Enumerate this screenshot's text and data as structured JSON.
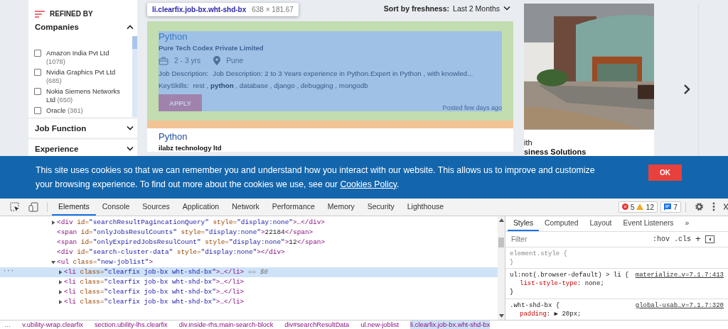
{
  "sidebar": {
    "title": "REFINED BY",
    "sections": [
      {
        "title": "Companies",
        "expanded": true,
        "options": [
          {
            "label": "Amazon India Pvt Ltd",
            "count": "(1078)",
            "checked": false
          },
          {
            "label": "Nvidia Graphics Pvt Ltd",
            "count": "(685)",
            "checked": false
          },
          {
            "label": "Nokia Siemens Networks Ltd",
            "count": "(650)",
            "checked": false
          },
          {
            "label": "Oracle",
            "count": "(381)",
            "checked": false
          }
        ]
      },
      {
        "title": "Job Function",
        "expanded": false
      },
      {
        "title": "Experience",
        "expanded": false
      }
    ]
  },
  "sort": {
    "label": "Sort by freshness:",
    "value": "Last 2 Months"
  },
  "inspect_tooltip": {
    "selector": "li.clearfix.job-bx.wht-shd-bx",
    "size": "638 × 181.67"
  },
  "jobs": [
    {
      "title": "Python",
      "company": "Pure Tech Codex Private Limited",
      "experience": "2 - 3 yrs",
      "location": "Pune",
      "description_label": "Job Description:",
      "description": "Job Description: 2 to 3 Years experience in Python.Expert in Python , with knowled...",
      "skills_label": "KeySkills:",
      "skills": "rest , **python** , database , django , debugging , mongodb",
      "button": "APPLY",
      "posted": "Posted few days ago",
      "highlighted": true
    },
    {
      "title": "Python",
      "company": "ilabz technology ltd",
      "highlighted": false
    }
  ],
  "promo": {
    "kind": "picture",
    "line_1": "ith",
    "line_2": "siness Solutions"
  },
  "cookie_banner": {
    "text": "This site uses cookies so that we can remember you and understand how you interact with our website. This allows us to improve and customize your browsing experience. To find out more about the cookies we use, see our ",
    "link": "Cookies Policy",
    "end": ".",
    "button": "OK"
  },
  "devtools": {
    "tabs": [
      {
        "label": "Elements",
        "selected": true
      },
      {
        "label": "Console",
        "selected": false
      },
      {
        "label": "Sources",
        "selected": false
      },
      {
        "label": "Application",
        "selected": false
      },
      {
        "label": "Network",
        "selected": false
      },
      {
        "label": "Performance",
        "selected": false
      },
      {
        "label": "Memory",
        "selected": false
      },
      {
        "label": "Security",
        "selected": false
      },
      {
        "label": "Lighthouse",
        "selected": false
      }
    ],
    "errors": "5",
    "warnings": "12",
    "messages": "7",
    "gutter_mark": "···",
    "dom": [
      {
        "collapsible": true,
        "expanded": false,
        "selected": false,
        "tokens": [
          {
            "kind": "tag",
            "text": "<div"
          },
          {
            "kind": "attr",
            "text": " id="
          },
          {
            "kind": "value",
            "text": "\"searchResultPagincationQuery\""
          },
          {
            "kind": "attr",
            "text": " style="
          },
          {
            "kind": "value",
            "text": "\"display:none\""
          },
          {
            "kind": "tag",
            "text": ">…</div>"
          }
        ]
      },
      {
        "collapsible": false,
        "selected": false,
        "tokens": [
          {
            "kind": "tag",
            "text": "<span"
          },
          {
            "kind": "attr",
            "text": " id="
          },
          {
            "kind": "value",
            "text": "\"onlyJobsResulCounts\""
          },
          {
            "kind": "attr",
            "text": " style="
          },
          {
            "kind": "value",
            "text": "\"display:none\""
          },
          {
            "kind": "tag",
            "text": ">"
          },
          {
            "kind": "text",
            "text": "22184"
          },
          {
            "kind": "tag",
            "text": "</span>"
          }
        ]
      },
      {
        "collapsible": false,
        "selected": false,
        "tokens": [
          {
            "kind": "tag",
            "text": "<span"
          },
          {
            "kind": "attr",
            "text": " id="
          },
          {
            "kind": "value",
            "text": "\"onlyExpiredJobsResulCount\""
          },
          {
            "kind": "attr",
            "text": " style="
          },
          {
            "kind": "value",
            "text": "\"display:none\""
          },
          {
            "kind": "tag",
            "text": ">"
          },
          {
            "kind": "text",
            "text": "12"
          },
          {
            "kind": "tag",
            "text": "</span>"
          }
        ]
      },
      {
        "collapsible": false,
        "selected": false,
        "tokens": [
          {
            "kind": "tag",
            "text": "<div"
          },
          {
            "kind": "attr",
            "text": " id="
          },
          {
            "kind": "value",
            "text": "\"search-cluster-data\""
          },
          {
            "kind": "attr",
            "text": " style="
          },
          {
            "kind": "value",
            "text": "\"display:none\""
          },
          {
            "kind": "tag",
            "text": "></div>"
          }
        ]
      },
      {
        "collapsible": true,
        "expanded": true,
        "selected": false,
        "tokens": [
          {
            "kind": "tag",
            "text": "<ul"
          },
          {
            "kind": "attr",
            "text": " class="
          },
          {
            "kind": "value",
            "text": "\"new-joblist\""
          },
          {
            "kind": "tag",
            "text": ">"
          }
        ],
        "children": [
          {
            "collapsible": true,
            "expanded": false,
            "selected": true,
            "tokens": [
              {
                "kind": "tag",
                "text": "<li"
              },
              {
                "kind": "attr",
                "text": " class="
              },
              {
                "kind": "value",
                "text": "\"clearfix job-bx wht-shd-bx\""
              },
              {
                "kind": "tag",
                "text": ">…</li>"
              },
              {
                "kind": "dim",
                "text": " == $0"
              }
            ]
          },
          {
            "collapsible": true,
            "expanded": false,
            "selected": false,
            "tokens": [
              {
                "kind": "tag",
                "text": "<li"
              },
              {
                "kind": "attr",
                "text": " class="
              },
              {
                "kind": "value",
                "text": "\"clearfix job-bx wht-shd-bx\""
              },
              {
                "kind": "tag",
                "text": ">…</li>"
              }
            ]
          },
          {
            "collapsible": true,
            "expanded": false,
            "selected": false,
            "tokens": [
              {
                "kind": "tag",
                "text": "<li"
              },
              {
                "kind": "attr",
                "text": " class="
              },
              {
                "kind": "value",
                "text": "\"clearfix job-bx wht-shd-bx\""
              },
              {
                "kind": "tag",
                "text": ">…</li>"
              }
            ]
          },
          {
            "collapsible": true,
            "expanded": false,
            "selected": false,
            "tokens": [
              {
                "kind": "tag",
                "text": "<li"
              },
              {
                "kind": "attr",
                "text": " class="
              },
              {
                "kind": "value",
                "text": "\"clearfix job-bx wht-shd-bx\""
              },
              {
                "kind": "tag",
                "text": ">…</li>"
              }
            ]
          }
        ]
      }
    ],
    "breadcrumb_more": "…",
    "breadcrumbs": [
      {
        "label": "v.ubility-wrap.clearfix",
        "selected": false
      },
      {
        "label": "section.ubility-lhs.clearfix",
        "selected": false
      },
      {
        "label": "div.inside-rhs.main-search-block",
        "selected": false
      },
      {
        "label": "div#searchResultData",
        "selected": false
      },
      {
        "label": "ul.new-joblist",
        "selected": false
      },
      {
        "label": "li.clearfix.job-bx.wht-shd-bx",
        "selected": true
      }
    ],
    "style_tabs": [
      {
        "label": "Styles",
        "selected": true
      },
      {
        "label": "Computed",
        "selected": false
      },
      {
        "label": "Layout",
        "selected": false
      },
      {
        "label": "Event Listeners",
        "selected": false
      },
      {
        "label": "»",
        "selected": false
      }
    ],
    "filter_placeholder": "Filter",
    "hov": ":hov",
    "cls": ".cls",
    "add": "+",
    "rules": [
      {
        "selector": "element.style {",
        "dimmed": true,
        "close": "}"
      },
      {
        "selector": "ul:not(.browser-default) > li {",
        "dimmed": false,
        "source": "materialize…v=7.1.7:413",
        "props": [
          {
            "name": "list-style-type",
            "sep": ": ",
            "value": "none;"
          }
        ],
        "close": "}"
      },
      {
        "selector": ".wht-shd-bx {",
        "dimmed": false,
        "source": "global-usab…v=7.1.7:320",
        "props": [
          {
            "name": "padding",
            "sep": ": ",
            "value": "▶ 20px;"
          }
        ]
      }
    ]
  }
}
